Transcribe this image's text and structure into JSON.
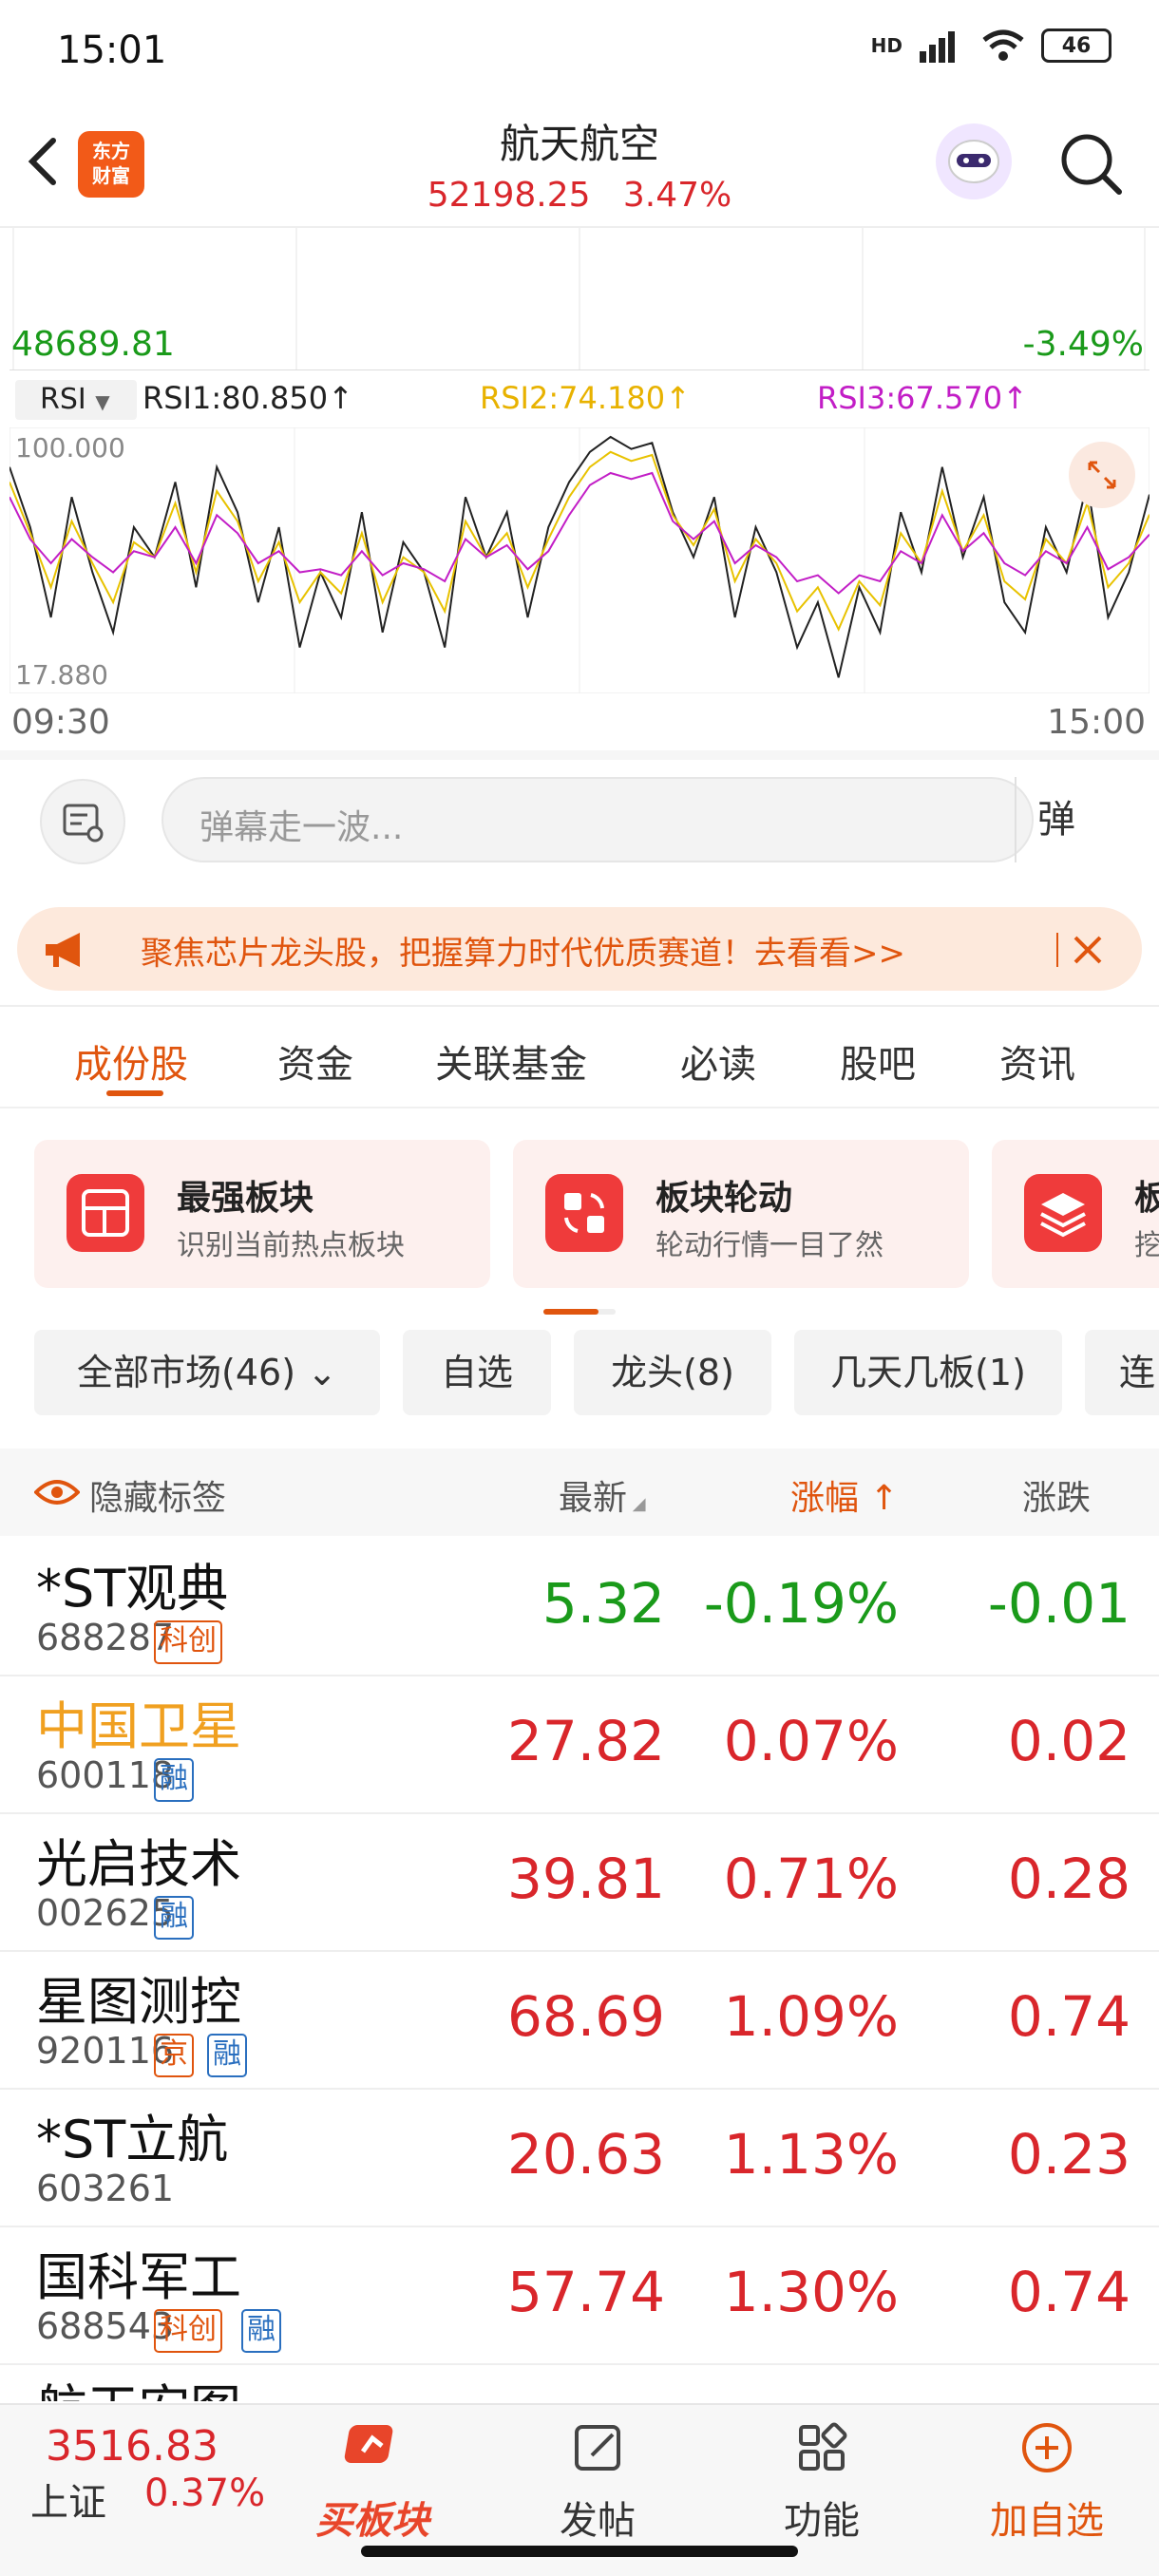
{
  "status_bar": {
    "time": "15:01",
    "network": "HD",
    "battery": "46"
  },
  "header": {
    "logo_text_line1": "东方",
    "logo_text_line2": "财富",
    "title": "航天航空",
    "price": "52198.25",
    "change_pct": "3.47%"
  },
  "upper_chart": {
    "left_value": "48689.81",
    "right_value": "-3.49%"
  },
  "rsi": {
    "selector": "RSI",
    "rsi1": "RSI1:80.850↑",
    "rsi2": "RSI2:74.180↑",
    "rsi3": "RSI3:67.570↑",
    "y_max": "100.000",
    "y_min": "17.880",
    "time_start": "09:30",
    "time_end": "15:00",
    "colors": {
      "rsi1": "#222222",
      "rsi2": "#e8c200",
      "rsi3": "#c21ec6"
    }
  },
  "chart_data": {
    "type": "line",
    "title": "",
    "xlabel": "",
    "ylabel": "",
    "x_range": [
      "09:30",
      "15:00"
    ],
    "ylim": [
      17.88,
      100.0
    ],
    "series": [
      {
        "name": "RSI1",
        "values": [
          90,
          70,
          40,
          80,
          55,
          35,
          70,
          60,
          85,
          50,
          90,
          75,
          45,
          70,
          30,
          55,
          40,
          75,
          35,
          65,
          55,
          30,
          80,
          60,
          75,
          40,
          70,
          85,
          95,
          100,
          96,
          98,
          75,
          60,
          80,
          40,
          70,
          55,
          30,
          45,
          20,
          50,
          35,
          75,
          55,
          90,
          60,
          80,
          45,
          35,
          70,
          55,
          85,
          40,
          55,
          80.85
        ]
      },
      {
        "name": "RSI2",
        "values": [
          85,
          68,
          50,
          72,
          58,
          45,
          65,
          60,
          78,
          55,
          82,
          72,
          52,
          65,
          45,
          55,
          48,
          68,
          45,
          60,
          55,
          42,
          72,
          60,
          68,
          50,
          66,
          80,
          90,
          95,
          92,
          94,
          74,
          64,
          76,
          52,
          66,
          58,
          42,
          50,
          36,
          52,
          44,
          68,
          58,
          82,
          62,
          74,
          52,
          46,
          66,
          58,
          78,
          50,
          58,
          74.18
        ]
      },
      {
        "name": "RSI3",
        "values": [
          80,
          66,
          58,
          66,
          60,
          55,
          62,
          60,
          70,
          58,
          74,
          68,
          58,
          62,
          55,
          56,
          54,
          62,
          54,
          58,
          56,
          52,
          66,
          60,
          64,
          56,
          62,
          74,
          84,
          88,
          86,
          88,
          72,
          66,
          72,
          58,
          64,
          60,
          52,
          54,
          48,
          54,
          52,
          62,
          58,
          74,
          62,
          68,
          58,
          54,
          62,
          58,
          70,
          56,
          60,
          67.57
        ]
      }
    ]
  },
  "danmaku": {
    "placeholder": "弹幕走一波...",
    "button": "弹"
  },
  "banner": {
    "text": "聚焦芯片龙头股，把握算力时代优质赛道！去看看>>"
  },
  "tabs": [
    "成份股",
    "资金",
    "关联基金",
    "必读",
    "股吧",
    "资讯"
  ],
  "cards": [
    {
      "title": "最强板块",
      "subtitle": "识别当前热点板块"
    },
    {
      "title": "板块轮动",
      "subtitle": "轮动行情一目了然"
    },
    {
      "title": "板",
      "subtitle": "挖"
    }
  ],
  "filters": [
    "全部市场(46)",
    "自选",
    "龙头(8)",
    "几天几板(1)",
    "连"
  ],
  "table_header": {
    "hide_tags": "隐藏标签",
    "latest": "最新",
    "change_pct": "涨幅",
    "change": "涨跌"
  },
  "rows": [
    {
      "name": "*ST观典",
      "code": "688287",
      "tags": [
        "科创"
      ],
      "price": "5.32",
      "pct": "-0.19%",
      "chg": "-0.01",
      "color": "#1a9a1a",
      "name_color": "#111"
    },
    {
      "name": "中国卫星",
      "code": "600118",
      "tags": [
        "融"
      ],
      "price": "27.82",
      "pct": "0.07%",
      "chg": "0.02",
      "color": "#d9262b",
      "name_color": "#f0a020"
    },
    {
      "name": "光启技术",
      "code": "002625",
      "tags": [
        "融"
      ],
      "price": "39.81",
      "pct": "0.71%",
      "chg": "0.28",
      "color": "#d9262b",
      "name_color": "#111"
    },
    {
      "name": "星图测控",
      "code": "920116",
      "tags": [
        "京",
        "融"
      ],
      "price": "68.69",
      "pct": "1.09%",
      "chg": "0.74",
      "color": "#d9262b",
      "name_color": "#111"
    },
    {
      "name": "*ST立航",
      "code": "603261",
      "tags": [],
      "price": "20.63",
      "pct": "1.13%",
      "chg": "0.23",
      "color": "#d9262b",
      "name_color": "#111"
    },
    {
      "name": "国科军工",
      "code": "688543",
      "tags": [
        "科创",
        "融"
      ],
      "price": "57.74",
      "pct": "1.30%",
      "chg": "0.74",
      "color": "#d9262b",
      "name_color": "#111"
    }
  ],
  "bottom_bar": {
    "index_value": "3516.83",
    "index_name": "上证",
    "index_pct": "0.37%",
    "nav": [
      "买板块",
      "发帖",
      "功能",
      "加自选"
    ]
  }
}
